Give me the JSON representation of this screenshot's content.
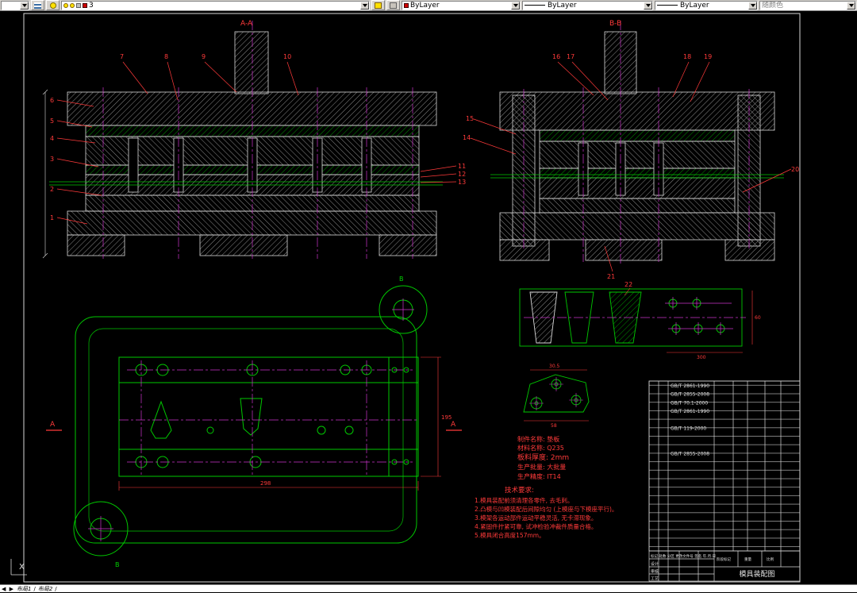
{
  "toolbar": {
    "layer_value": "3",
    "color_value": "ByLayer",
    "linetype_value": "ByLayer",
    "lineweight_value": "ByLayer",
    "plotstyle_value": "随颜色"
  },
  "tabs": {
    "nav": "◀ ▶",
    "tab1": "布局1",
    "tab2": "布局2",
    "separator": "/"
  },
  "ucs": {
    "x_label": "X"
  },
  "sectionA": {
    "label": "A-A",
    "left": [
      "6",
      "5",
      "4",
      "3",
      "2",
      "1"
    ],
    "top": [
      "7",
      "8",
      "9",
      "10"
    ],
    "right": [
      "11",
      "12",
      "13"
    ]
  },
  "sectionB": {
    "label": "B-B",
    "left": [
      "15",
      "14"
    ],
    "top": [
      "16",
      "17",
      "18",
      "19"
    ],
    "right": [
      "20"
    ],
    "bottom": [
      "21"
    ]
  },
  "strip": {
    "callout": "22",
    "dim_right": "60",
    "dim_bottom": "300"
  },
  "plan": {
    "label_top": "B",
    "label_bottom": "B",
    "section_left": "A",
    "section_right": "A",
    "dim_bottom": "298",
    "dim_right": "195"
  },
  "detail": {
    "dim_top": "30.5",
    "dim_bottom": "58"
  },
  "part_info": [
    "制件名称: 垫板",
    "材料名称: Q235",
    "板料厚度: 2mm",
    "生产批量: 大批量",
    "生产精度: IT14"
  ],
  "notes": {
    "title": "技术要求:",
    "lines": [
      "1.模具装配前须清理各零件, 去毛刺。",
      "2.凸模与凹模装配后间隙均匀 (上模座与下模座平行)。",
      "3.模架各运动部件运动平稳灵活, 无卡滞现象。",
      "4.紧固件拧紧可靠, 试冲检验冲裁件质量合格。",
      "5.模具闭合高度157mm。"
    ]
  },
  "bom_codes": [
    "GB/T 2861-1990",
    "GB/T 2855-2008",
    "GB/T 70.1-2000",
    "GB/T 2861-1990",
    "GB/T 119-2000",
    "GB/T 2855-2008"
  ],
  "title_block": {
    "title": "模具装配图",
    "header_labels": "标记 处数 分区 更改文件号 签名 年.月.日",
    "row1": "设计",
    "row2": "审核",
    "row3": "工艺",
    "cell_stage": "阶段标记",
    "cell_weight": "重量",
    "cell_scale": "比例"
  }
}
